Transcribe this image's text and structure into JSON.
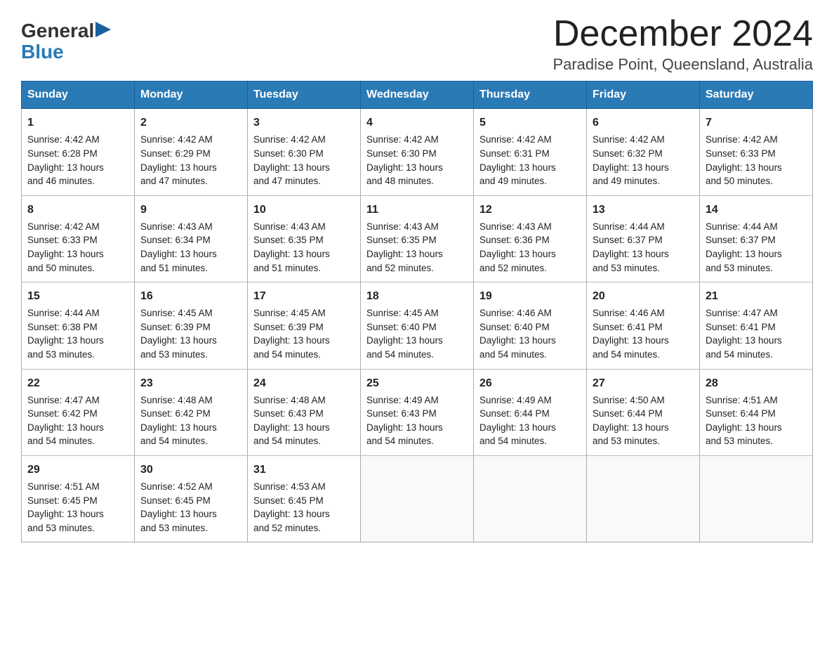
{
  "header": {
    "logo_general": "General",
    "logo_blue": "Blue",
    "month_title": "December 2024",
    "location": "Paradise Point, Queensland, Australia"
  },
  "days_of_week": [
    "Sunday",
    "Monday",
    "Tuesday",
    "Wednesday",
    "Thursday",
    "Friday",
    "Saturday"
  ],
  "weeks": [
    [
      {
        "day": "1",
        "sunrise": "4:42 AM",
        "sunset": "6:28 PM",
        "daylight": "13 hours and 46 minutes."
      },
      {
        "day": "2",
        "sunrise": "4:42 AM",
        "sunset": "6:29 PM",
        "daylight": "13 hours and 47 minutes."
      },
      {
        "day": "3",
        "sunrise": "4:42 AM",
        "sunset": "6:30 PM",
        "daylight": "13 hours and 47 minutes."
      },
      {
        "day": "4",
        "sunrise": "4:42 AM",
        "sunset": "6:30 PM",
        "daylight": "13 hours and 48 minutes."
      },
      {
        "day": "5",
        "sunrise": "4:42 AM",
        "sunset": "6:31 PM",
        "daylight": "13 hours and 49 minutes."
      },
      {
        "day": "6",
        "sunrise": "4:42 AM",
        "sunset": "6:32 PM",
        "daylight": "13 hours and 49 minutes."
      },
      {
        "day": "7",
        "sunrise": "4:42 AM",
        "sunset": "6:33 PM",
        "daylight": "13 hours and 50 minutes."
      }
    ],
    [
      {
        "day": "8",
        "sunrise": "4:42 AM",
        "sunset": "6:33 PM",
        "daylight": "13 hours and 50 minutes."
      },
      {
        "day": "9",
        "sunrise": "4:43 AM",
        "sunset": "6:34 PM",
        "daylight": "13 hours and 51 minutes."
      },
      {
        "day": "10",
        "sunrise": "4:43 AM",
        "sunset": "6:35 PM",
        "daylight": "13 hours and 51 minutes."
      },
      {
        "day": "11",
        "sunrise": "4:43 AM",
        "sunset": "6:35 PM",
        "daylight": "13 hours and 52 minutes."
      },
      {
        "day": "12",
        "sunrise": "4:43 AM",
        "sunset": "6:36 PM",
        "daylight": "13 hours and 52 minutes."
      },
      {
        "day": "13",
        "sunrise": "4:44 AM",
        "sunset": "6:37 PM",
        "daylight": "13 hours and 53 minutes."
      },
      {
        "day": "14",
        "sunrise": "4:44 AM",
        "sunset": "6:37 PM",
        "daylight": "13 hours and 53 minutes."
      }
    ],
    [
      {
        "day": "15",
        "sunrise": "4:44 AM",
        "sunset": "6:38 PM",
        "daylight": "13 hours and 53 minutes."
      },
      {
        "day": "16",
        "sunrise": "4:45 AM",
        "sunset": "6:39 PM",
        "daylight": "13 hours and 53 minutes."
      },
      {
        "day": "17",
        "sunrise": "4:45 AM",
        "sunset": "6:39 PM",
        "daylight": "13 hours and 54 minutes."
      },
      {
        "day": "18",
        "sunrise": "4:45 AM",
        "sunset": "6:40 PM",
        "daylight": "13 hours and 54 minutes."
      },
      {
        "day": "19",
        "sunrise": "4:46 AM",
        "sunset": "6:40 PM",
        "daylight": "13 hours and 54 minutes."
      },
      {
        "day": "20",
        "sunrise": "4:46 AM",
        "sunset": "6:41 PM",
        "daylight": "13 hours and 54 minutes."
      },
      {
        "day": "21",
        "sunrise": "4:47 AM",
        "sunset": "6:41 PM",
        "daylight": "13 hours and 54 minutes."
      }
    ],
    [
      {
        "day": "22",
        "sunrise": "4:47 AM",
        "sunset": "6:42 PM",
        "daylight": "13 hours and 54 minutes."
      },
      {
        "day": "23",
        "sunrise": "4:48 AM",
        "sunset": "6:42 PM",
        "daylight": "13 hours and 54 minutes."
      },
      {
        "day": "24",
        "sunrise": "4:48 AM",
        "sunset": "6:43 PM",
        "daylight": "13 hours and 54 minutes."
      },
      {
        "day": "25",
        "sunrise": "4:49 AM",
        "sunset": "6:43 PM",
        "daylight": "13 hours and 54 minutes."
      },
      {
        "day": "26",
        "sunrise": "4:49 AM",
        "sunset": "6:44 PM",
        "daylight": "13 hours and 54 minutes."
      },
      {
        "day": "27",
        "sunrise": "4:50 AM",
        "sunset": "6:44 PM",
        "daylight": "13 hours and 53 minutes."
      },
      {
        "day": "28",
        "sunrise": "4:51 AM",
        "sunset": "6:44 PM",
        "daylight": "13 hours and 53 minutes."
      }
    ],
    [
      {
        "day": "29",
        "sunrise": "4:51 AM",
        "sunset": "6:45 PM",
        "daylight": "13 hours and 53 minutes."
      },
      {
        "day": "30",
        "sunrise": "4:52 AM",
        "sunset": "6:45 PM",
        "daylight": "13 hours and 53 minutes."
      },
      {
        "day": "31",
        "sunrise": "4:53 AM",
        "sunset": "6:45 PM",
        "daylight": "13 hours and 52 minutes."
      },
      null,
      null,
      null,
      null
    ]
  ],
  "labels": {
    "sunrise": "Sunrise:",
    "sunset": "Sunset:",
    "daylight": "Daylight:"
  }
}
